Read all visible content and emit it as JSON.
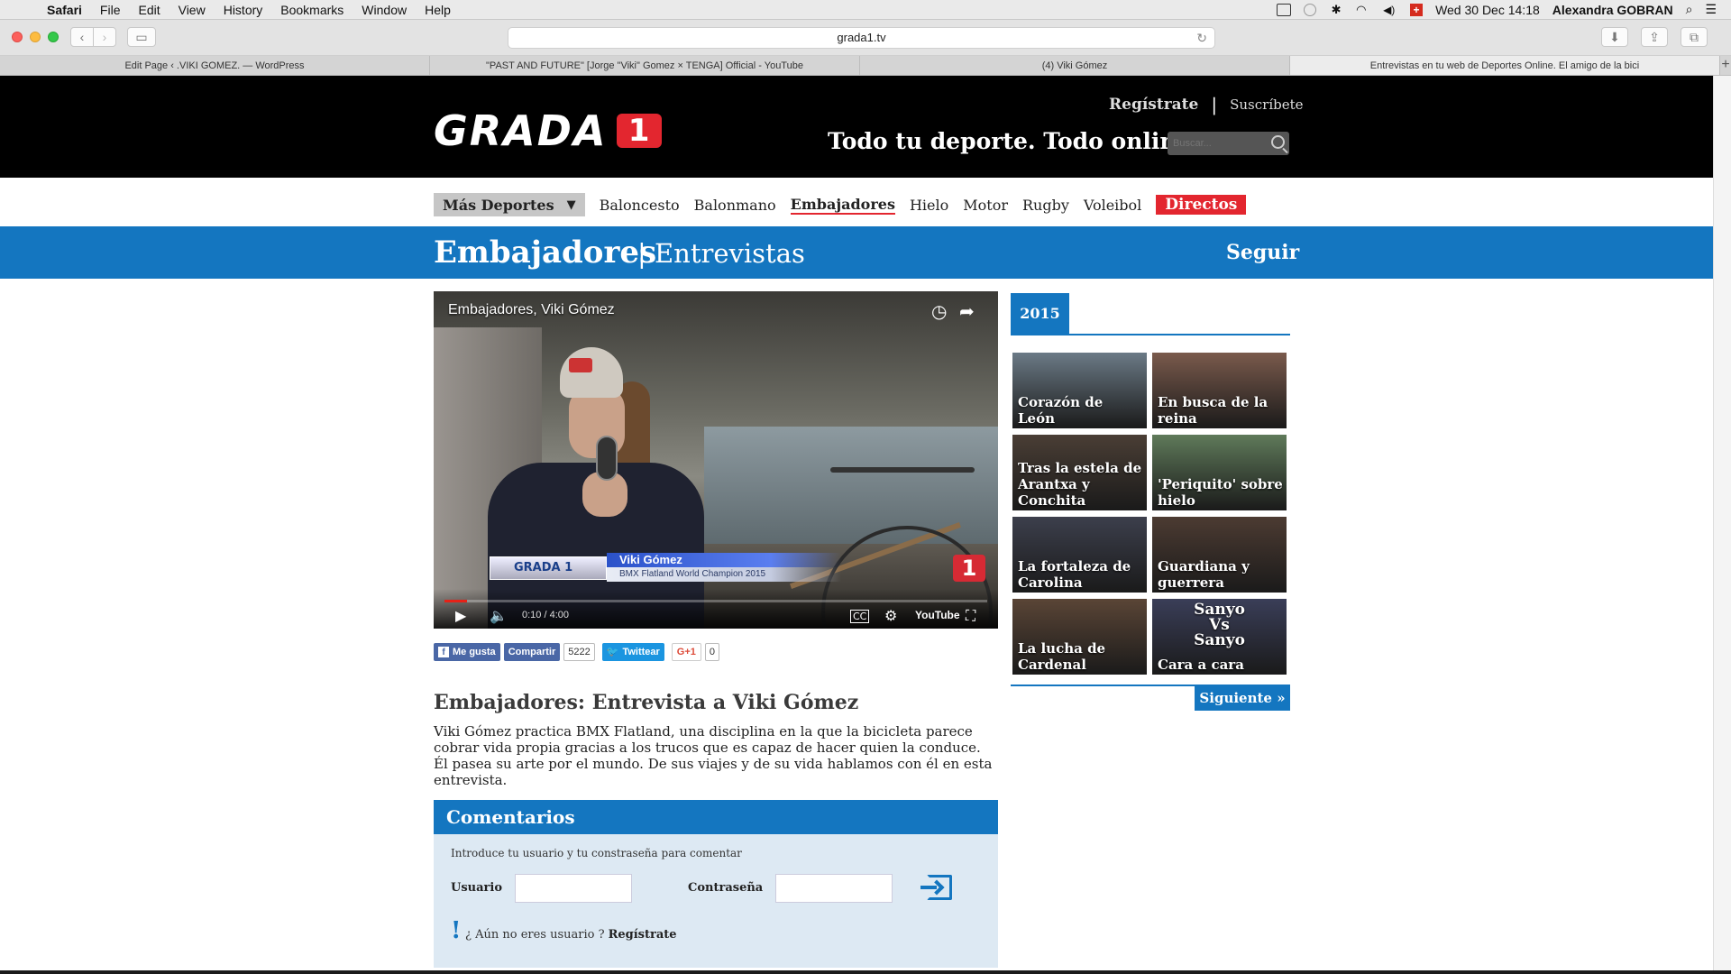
{
  "menubar": {
    "app": "Safari",
    "items": [
      "File",
      "Edit",
      "View",
      "History",
      "Bookmarks",
      "Window",
      "Help"
    ],
    "datetime": "Wed 30 Dec  14:18",
    "user": "Alexandra GOBRAN"
  },
  "browser": {
    "url": "grada1.tv",
    "tabs": [
      "Edit Page ‹ .VIKI GOMEZ. — WordPress",
      "\"PAST AND FUTURE\" [Jorge \"Viki\" Gomez × TENGA] Official - YouTube",
      "(4) Viki Gómez",
      "Entrevistas en tu web de Deportes Online. El amigo de la bici"
    ],
    "active_tab": 3
  },
  "header": {
    "logo_text": "GRADA",
    "logo_number": "1",
    "register": "Regístrate",
    "separator": "|",
    "subscribe": "Suscríbete",
    "tagline": "Todo tu deporte. Todo online.",
    "search_placeholder": "Buscar..."
  },
  "nav": {
    "more": "Más Deportes",
    "items": [
      "Baloncesto",
      "Balonmano",
      "Embajadores",
      "Hielo",
      "Motor",
      "Rugby",
      "Voleibol"
    ],
    "active": "Embajadores",
    "live": "Directos"
  },
  "section": {
    "title": "Embajadores",
    "subtitle": "| Entrevistas",
    "follow": "Seguir"
  },
  "video": {
    "title": "Embajadores, Viki Gómez",
    "lower_third_brand": "GRADA 1",
    "lower_third_name": "Viki Gómez",
    "lower_third_subtitle": "BMX Flatland World Champion 2015",
    "time": "0:10 / 4:00",
    "progress": 0.042,
    "youtube_label": "YouTube",
    "channel_badge": "1"
  },
  "social": {
    "fb_like": "Me gusta",
    "share": "Compartir",
    "share_count": "5222",
    "tweet": "Twittear",
    "gplus": "G+1",
    "gplus_count": "0"
  },
  "article": {
    "title": "Embajadores: Entrevista a Viki Gómez",
    "body": "Viki Gómez practica BMX Flatland, una disciplina en la que la bicicleta parece cobrar vida propia gracias a los trucos que es capaz de hacer quien la conduce. Él pasea su arte por el mundo. De sus viajes y de su vida hablamos con él en esta entrevista."
  },
  "comments": {
    "title": "Comentarios",
    "hint": "Introduce tu usuario y tu constraseña para comentar",
    "user_label": "Usuario",
    "password_label": "Contraseña",
    "not_user": "¿ Aún no eres usuario ?",
    "register": "Regístrate"
  },
  "sidebar": {
    "year": "2015",
    "thumbs": [
      {
        "caption": "Corazón de León",
        "bg": "#6b7a86"
      },
      {
        "caption": "En busca de la reina",
        "bg": "#7a5a4c"
      },
      {
        "caption": "Tras la estela de Arantxa y Conchita",
        "bg": "#4a3e35"
      },
      {
        "caption": "'Periquito' sobre hielo",
        "bg": "#5f7a5a"
      },
      {
        "caption": "La fortaleza de Carolina",
        "bg": "#3c3f4c"
      },
      {
        "caption": "Guardiana y guerrera",
        "bg": "#4c3b32"
      },
      {
        "caption": "La lucha de Cardenal",
        "bg": "#5a4536"
      },
      {
        "caption": "Cara a cara",
        "bg": "#3a3e58",
        "overlay": "Sanyo\nVs\nSanyo"
      }
    ],
    "next": "Siguiente »"
  }
}
